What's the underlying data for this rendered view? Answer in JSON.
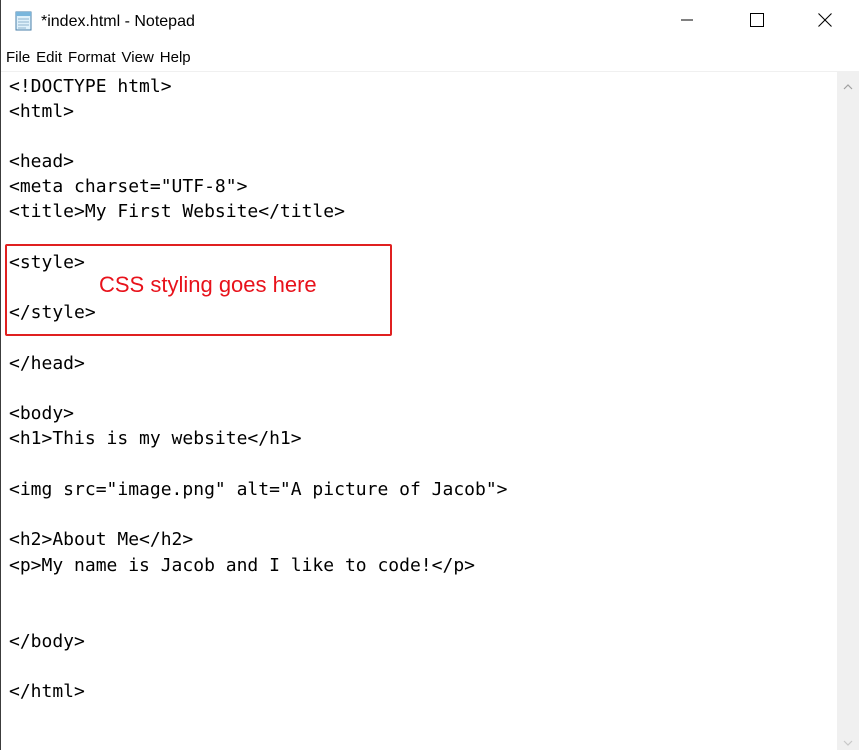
{
  "window": {
    "title": "*index.html - Notepad"
  },
  "menu": [
    "File",
    "Edit",
    "Format",
    "View",
    "Help"
  ],
  "editor": {
    "lines": [
      "<!DOCTYPE html>",
      "<html>",
      "",
      "<head>",
      "<meta charset=\"UTF-8\">",
      "<title>My First Website</title>",
      "",
      "<style>",
      "",
      "</style>",
      "",
      "</head>",
      "",
      "<body>",
      "<h1>This is my website</h1>",
      "",
      "<img src=\"image.png\" alt=\"A picture of Jacob\">",
      "",
      "<h2>About Me</h2>",
      "<p>My name is Jacob and I like to code!</p>",
      "",
      "",
      "</body>",
      "",
      "</html>"
    ]
  },
  "annotation": {
    "text": "CSS styling goes here",
    "color": "#e8121b"
  },
  "colors": {
    "highlight_border": "#e02020",
    "scrollbar": "#f0f0f0"
  },
  "icons": {
    "app": "notepad-icon",
    "minimize": "minimize-icon",
    "maximize": "maximize-icon",
    "close": "close-icon",
    "scroll_up": "scroll-up-arrow-icon",
    "scroll_down": "scroll-down-arrow-icon"
  }
}
